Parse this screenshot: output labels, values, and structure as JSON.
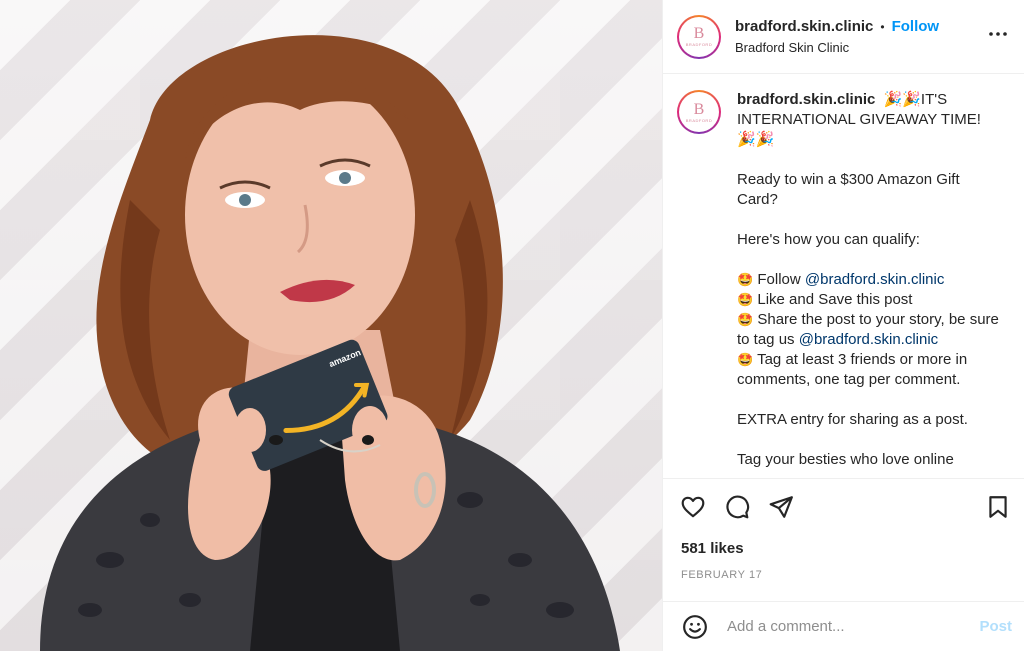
{
  "post": {
    "image_alt": "Woman holding an Amazon gift card",
    "gift_card_brand": "amazon"
  },
  "header": {
    "username": "bradford.skin.clinic",
    "separator": "•",
    "follow_label": "Follow",
    "display_name": "Bradford Skin Clinic",
    "more_label": "..."
  },
  "avatar": {
    "initial": "B",
    "word": "BRADFORD"
  },
  "caption": {
    "username": "bradford.skin.clinic",
    "line1": "🎉🎉IT'S INTERNATIONAL GIVEAWAY TIME! 🎉🎉",
    "line2": "Ready to win a $300 Amazon Gift Card?",
    "line3": "Here's how you can qualify:",
    "item1_emoji": "🤩",
    "item1_text": "Follow",
    "item1_mention": "@bradford.skin.clinic",
    "item2_emoji": "🤩",
    "item2_text": "Like and Save this post",
    "item3_emoji": "🤩",
    "item3_text": "Share the post to your story, be sure to tag us",
    "item3_mention": "@bradford.skin.clinic",
    "item4_emoji": "🤩",
    "item4_text": "Tag at least 3 friends or more in comments, one tag per comment.",
    "line4": "EXTRA entry for sharing as a post.",
    "line5": "Tag your besties who love online"
  },
  "actions": {
    "like_icon": "heart-icon",
    "comment_icon": "comment-icon",
    "share_icon": "paper-plane-icon",
    "save_icon": "bookmark-icon"
  },
  "stats": {
    "likes": "581 likes",
    "date": "FEBRUARY 17"
  },
  "comment": {
    "placeholder": "Add a comment...",
    "post_label": "Post",
    "emoji_icon": "smiley-icon"
  },
  "colors": {
    "accent": "#0095f6",
    "mention": "#00376b",
    "post_disabled": "#b2dffc",
    "muted": "#8e8e8e"
  }
}
